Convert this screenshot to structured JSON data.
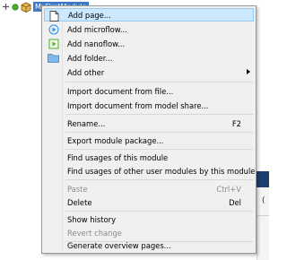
{
  "tree": {
    "node_label": "MyFirstModule",
    "toggle_icon": "plus-icon",
    "status_icon": "green-dot-icon",
    "module_icon": "module-box-icon"
  },
  "menu": {
    "items": [
      {
        "label": "Add page...",
        "icon": "page-icon",
        "selected": true
      },
      {
        "label": "Add microflow...",
        "icon": "microflow-icon"
      },
      {
        "label": "Add nanoflow...",
        "icon": "nanoflow-icon"
      },
      {
        "label": "Add folder...",
        "icon": "folder-icon"
      },
      {
        "label": "Add other",
        "submenu": true
      },
      {
        "label": "Import document from file..."
      },
      {
        "label": "Import document from model share..."
      },
      {
        "label": "Rename...",
        "shortcut": "F2"
      },
      {
        "label": "Export module package..."
      },
      {
        "label": "Find usages of this module"
      },
      {
        "label": "Find usages of other user modules by this module"
      },
      {
        "label": "Paste",
        "shortcut": "Ctrl+V",
        "disabled": true
      },
      {
        "label": "Delete",
        "shortcut": "Del"
      },
      {
        "label": "Show history"
      },
      {
        "label": "Revert change",
        "disabled": true
      },
      {
        "label": "Generate overview pages..."
      }
    ]
  },
  "background": {
    "partial_text": "("
  },
  "colors": {
    "menu_bg": "#f0f0f0",
    "selection_bg": "#cce8ff",
    "selection_border": "#99c9ef",
    "disabled_text": "#8c8c8c",
    "tree_selection": "#3d79c6"
  }
}
